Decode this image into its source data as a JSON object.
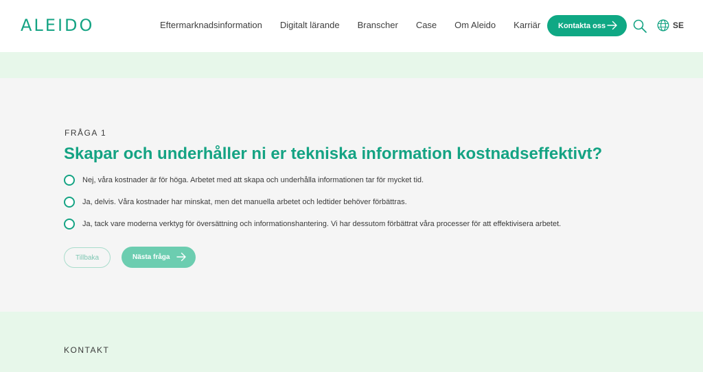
{
  "header": {
    "logo_text": "ALEIDO",
    "nav": [
      "Eftermarknadsinformation",
      "Digitalt lärande",
      "Branscher",
      "Case",
      "Om Aleido",
      "Karriär"
    ],
    "cta_label": "Kontakta oss",
    "language": "SE",
    "icons": {
      "cta_arrow": "arrow-right-icon",
      "search": "search-icon",
      "language": "globe-icon"
    }
  },
  "quiz": {
    "label": "FRÅGA 1",
    "title": "Skapar och underhåller ni er tekniska information kostnadseffektivt?",
    "options": [
      "Nej, våra kostnader är för höga. Arbetet med att skapa och underhålla informationen tar för mycket tid.",
      "Ja, delvis. Våra kostnader har minskat, men det manuella arbetet och ledtider behöver förbättras.",
      "Ja, tack vare moderna verktyg för översättning och informationshantering. Vi har dessutom förbättrat våra processer för att effektivisera arbetet."
    ],
    "back_label": "Tillbaka",
    "next_label": "Nästa fråga"
  },
  "footer": {
    "contact_label": "KONTAKT"
  },
  "colors": {
    "brand_green": "#14a383",
    "cta_green": "#0fa884",
    "next_disabled_green": "#6ccdb0",
    "band_mint": "#e7f7ea",
    "quiz_background": "#f5f5f5"
  }
}
